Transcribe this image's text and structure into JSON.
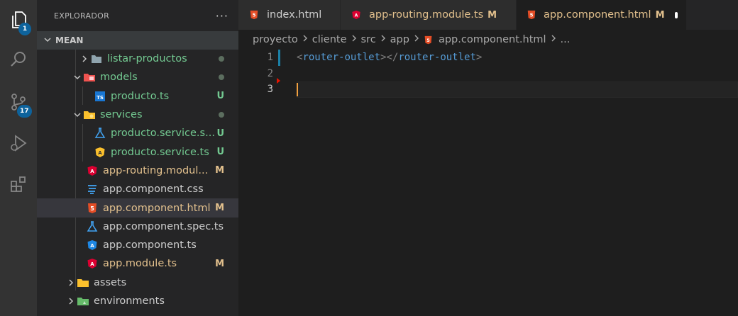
{
  "activity_bar": {
    "explorer_badge": "1",
    "scm_badge": "17"
  },
  "sidebar": {
    "title": "EXPLORADOR",
    "more": "···",
    "section": "MEAN",
    "items": [
      {
        "label": "listar-productos",
        "status": ""
      },
      {
        "label": "models",
        "status": ""
      },
      {
        "label": "producto.ts",
        "status": "U"
      },
      {
        "label": "services",
        "status": ""
      },
      {
        "label": "producto.service.s...",
        "status": "U"
      },
      {
        "label": "producto.service.ts",
        "status": "U"
      },
      {
        "label": "app-routing.modul...",
        "status": "M"
      },
      {
        "label": "app.component.css",
        "status": ""
      },
      {
        "label": "app.component.html",
        "status": "M"
      },
      {
        "label": "app.component.spec.ts",
        "status": ""
      },
      {
        "label": "app.component.ts",
        "status": ""
      },
      {
        "label": "app.module.ts",
        "status": "M"
      },
      {
        "label": "assets",
        "status": ""
      },
      {
        "label": "environments",
        "status": ""
      }
    ]
  },
  "tabs": [
    {
      "label": "index.html",
      "status": "",
      "icon": "html5-icon"
    },
    {
      "label": "app-routing.module.ts",
      "status": "M",
      "icon": "angular-icon"
    },
    {
      "label": "app.component.html",
      "status": "M",
      "icon": "html5-icon"
    }
  ],
  "breadcrumb": [
    "proyecto",
    "cliente",
    "src",
    "app",
    "app.component.html",
    "..."
  ],
  "editor": {
    "line_numbers": [
      "1",
      "2",
      "3"
    ],
    "line1": {
      "open_lt": "<",
      "open_tag": "router-outlet",
      "open_gt": "></",
      "close_tag": "router-outlet",
      "close_gt": ">"
    }
  },
  "colors": {
    "untracked": "#73c991",
    "modified": "#e2c08d",
    "angular": "#dd0031",
    "html5": "#e44d26",
    "css3": "#42a5f5",
    "accent": "#0e639c"
  }
}
